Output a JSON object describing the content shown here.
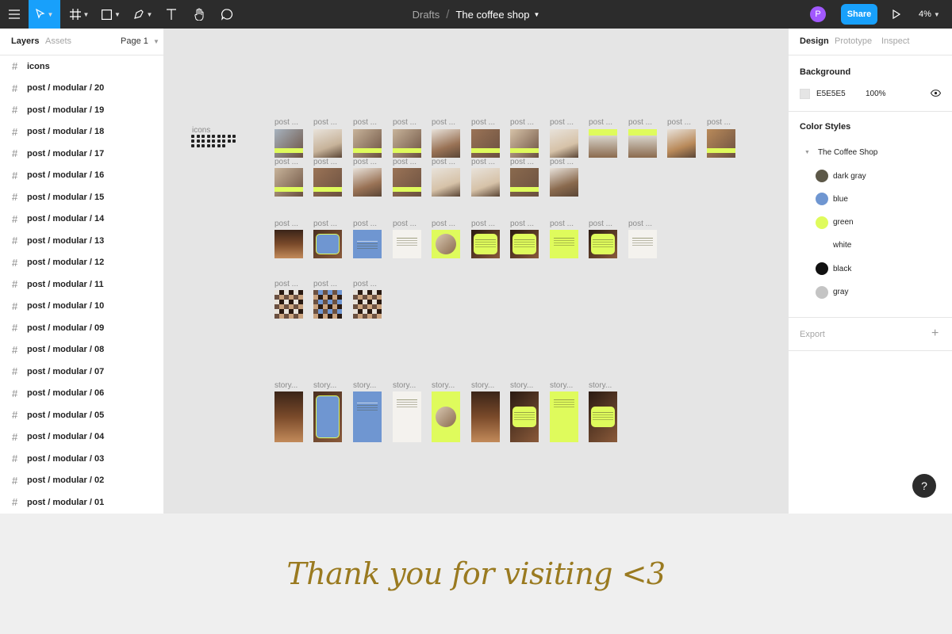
{
  "toolbar": {
    "breadcrumb": {
      "parent": "Drafts",
      "separator": "/",
      "file": "The coffee shop"
    },
    "avatar_initial": "P",
    "share_label": "Share",
    "zoom": "4%"
  },
  "left_panel": {
    "tabs": [
      "Layers",
      "Assets"
    ],
    "page": "Page 1",
    "layers": [
      "icons",
      "post / modular / 20",
      "post / modular / 19",
      "post / modular / 18",
      "post / modular / 17",
      "post / modular / 16",
      "post / modular / 15",
      "post / modular / 14",
      "post / modular / 13",
      "post / modular / 12",
      "post / modular / 11",
      "post / modular / 10",
      "post / modular / 09",
      "post / modular / 08",
      "post / modular / 07",
      "post / modular / 06",
      "post / modular / 05",
      "post / modular / 04",
      "post / modular / 03",
      "post / modular / 02",
      "post / modular / 01"
    ]
  },
  "canvas": {
    "icons_label": "icons",
    "post_label": "post ...",
    "story_label": "story..."
  },
  "right_panel": {
    "tabs": [
      "Design",
      "Prototype",
      "Inspect"
    ],
    "background": {
      "title": "Background",
      "hex": "E5E5E5",
      "opacity": "100%"
    },
    "color_styles": {
      "title": "Color Styles",
      "group": "The Coffee Shop",
      "items": [
        {
          "name": "dark gray",
          "color": "#5c5848"
        },
        {
          "name": "blue",
          "color": "#6f96d1"
        },
        {
          "name": "green",
          "color": "#dffb5c"
        },
        {
          "name": "white",
          "color": "#ffffff"
        },
        {
          "name": "black",
          "color": "#111111"
        },
        {
          "name": "gray",
          "color": "#c4c4c4"
        }
      ]
    },
    "export_label": "Export"
  },
  "help_label": "?",
  "footer": {
    "text": "Thank you for visiting <3"
  },
  "colors": {
    "accent": "#18a0fb",
    "toolbar_bg": "#2c2c2c",
    "canvas_bg": "#E5E5E5",
    "brand_text": "#9a7a20"
  }
}
